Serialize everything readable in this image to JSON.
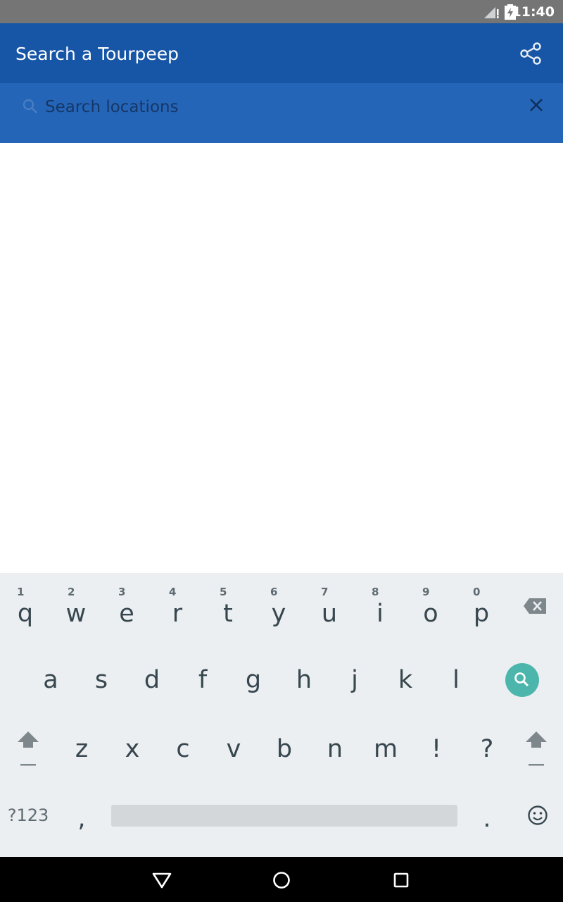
{
  "status_bar": {
    "time": "11:40"
  },
  "app_bar": {
    "title": "Search a Tourpeep"
  },
  "search": {
    "placeholder": "Search locations",
    "value": ""
  },
  "keyboard": {
    "row1": [
      {
        "k": "q",
        "h": "1"
      },
      {
        "k": "w",
        "h": "2"
      },
      {
        "k": "e",
        "h": "3"
      },
      {
        "k": "r",
        "h": "4"
      },
      {
        "k": "t",
        "h": "5"
      },
      {
        "k": "y",
        "h": "6"
      },
      {
        "k": "u",
        "h": "7"
      },
      {
        "k": "i",
        "h": "8"
      },
      {
        "k": "o",
        "h": "9"
      },
      {
        "k": "p",
        "h": "0"
      }
    ],
    "row2": [
      "a",
      "s",
      "d",
      "f",
      "g",
      "h",
      "j",
      "k",
      "l"
    ],
    "row3": [
      "z",
      "x",
      "c",
      "v",
      "b",
      "n",
      "m",
      "!",
      "?"
    ],
    "symbols_label": "?123",
    "comma": ",",
    "period": "."
  },
  "colors": {
    "app_bar": "#1756a6",
    "search_bar": "#2565b7",
    "search_key": "#4db6ac",
    "keyboard_bg": "#eceff1"
  }
}
